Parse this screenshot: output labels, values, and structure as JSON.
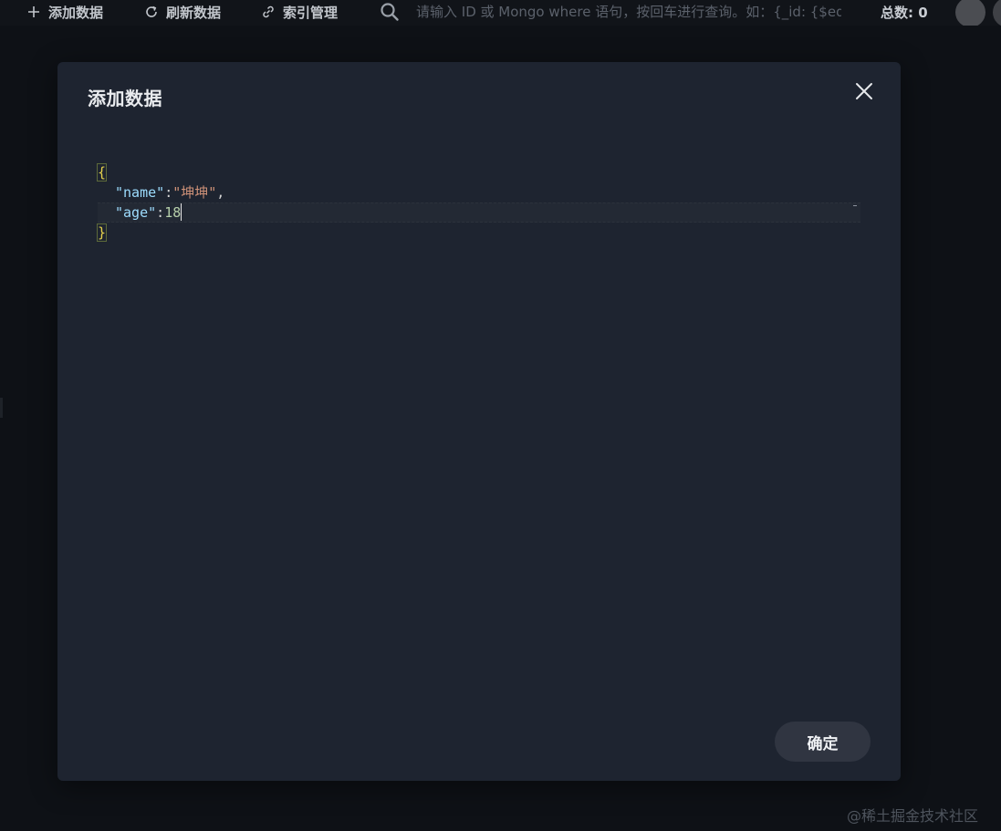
{
  "toolbar": {
    "add_label": "添加数据",
    "refresh_label": "刷新数据",
    "index_label": "索引管理",
    "search_placeholder": "请输入 ID 或 Mongo where 语句，按回车进行查询。如：{_id: {$eq: ...}}",
    "total_label": "总数: 0"
  },
  "icons": {
    "add": "plus-icon",
    "refresh": "refresh-icon",
    "index": "link-icon",
    "search": "search-icon",
    "close": "close-icon",
    "avatar": "avatar"
  },
  "modal": {
    "title": "添加数据",
    "confirm_label": "确定",
    "editor": {
      "open_brace": "{",
      "close_brace": "}",
      "name_key": "\"name\"",
      "name_value": "\"坤坤\"",
      "age_key": "\"age\"",
      "age_value": "18",
      "colon": ":",
      "comma": ","
    }
  },
  "watermark": "@稀土掘金技术社区",
  "colors": {
    "background": "#111419",
    "modal": "#1e2430",
    "button": "#303541",
    "json_key": "#9cdcfe",
    "json_string": "#ce9178",
    "json_number": "#b5cea8",
    "brace": "#e8d44d"
  }
}
